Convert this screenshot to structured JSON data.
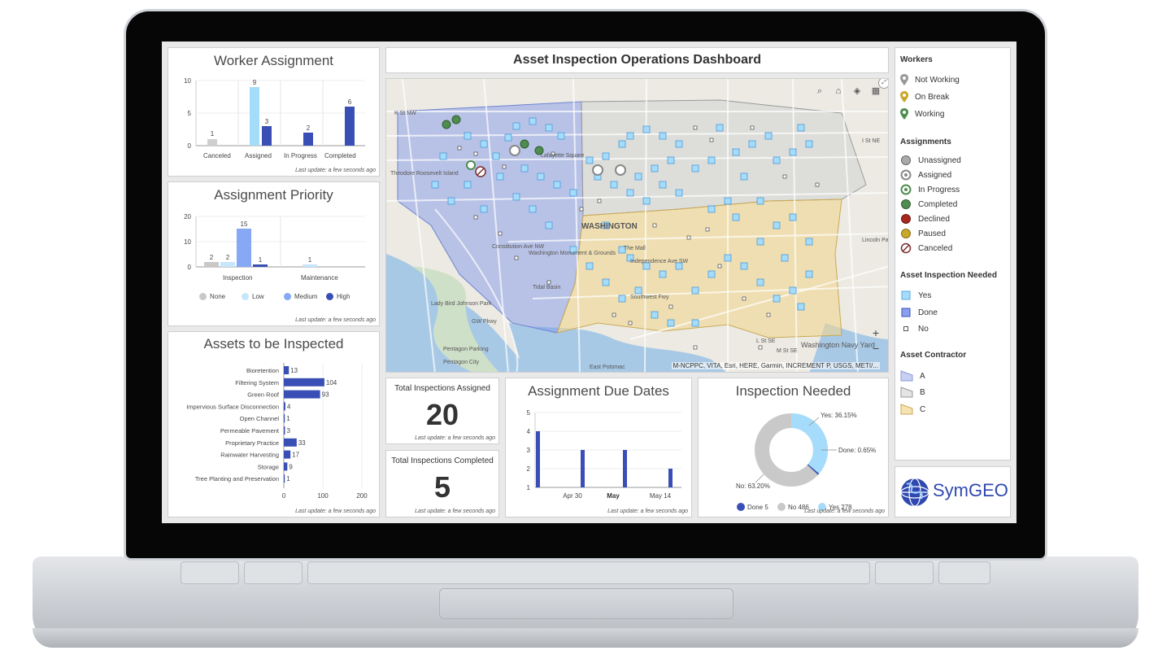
{
  "dashboard": {
    "title": "Asset Inspection Operations Dashboard",
    "update_text": "Last update: a few seconds ago"
  },
  "worker_assignment": {
    "title": "Worker Assignment",
    "chart_data": {
      "type": "bar",
      "categories": [
        "Canceled",
        "Assigned",
        "In Progress",
        "Completed"
      ],
      "bars": [
        {
          "category": "Canceled",
          "value": 1,
          "color": "#cfcfcf"
        },
        {
          "category": "Assigned",
          "value": 9,
          "color": "#a6dcfb"
        },
        {
          "category": "Assigned",
          "value": 3,
          "color": "#3a4fb5"
        },
        {
          "category": "In Progress",
          "value": 2,
          "color": "#3a4fb5"
        },
        {
          "category": "Completed",
          "value": 6,
          "color": "#3a4fb5"
        }
      ],
      "yticks": [
        "0",
        "5",
        "10"
      ],
      "ylim": [
        0,
        10
      ]
    }
  },
  "assignment_priority": {
    "title": "Assignment Priority",
    "chart_data": {
      "type": "bar",
      "categories": [
        "Inspection",
        "Maintenance"
      ],
      "series": [
        {
          "name": "None",
          "values": [
            2,
            0
          ],
          "color": "#c8c8c8"
        },
        {
          "name": "Low",
          "values": [
            2,
            1
          ],
          "color": "#c6e6fb"
        },
        {
          "name": "Medium",
          "values": [
            15,
            0
          ],
          "color": "#86a8f5"
        },
        {
          "name": "High",
          "values": [
            1,
            0
          ],
          "color": "#3a4fb5"
        }
      ],
      "yticks": [
        "0",
        "10",
        "20"
      ],
      "ylim": [
        0,
        20
      ]
    }
  },
  "assets_inspected": {
    "title": "Assets to be Inspected",
    "chart_data": {
      "type": "bar",
      "orientation": "horizontal",
      "categories": [
        "Bioretention",
        "Filtering System",
        "Green Roof",
        "Impervious Surface Disconnection",
        "Open Channel",
        "Permeable Pavement",
        "Proprietary Practice",
        "Rainwater Harvesting",
        "Storage",
        "Tree Planting and Preservation"
      ],
      "values": [
        13,
        104,
        93,
        4,
        1,
        3,
        33,
        17,
        9,
        1
      ],
      "xticks": [
        "0",
        "100",
        "200"
      ],
      "xlim": [
        0,
        200
      ],
      "color": "#3a4fb5"
    }
  },
  "total_assigned": {
    "title": "Total Inspections Assigned",
    "value": "20"
  },
  "total_completed": {
    "title": "Total Inspections Completed",
    "value": "5"
  },
  "due_dates": {
    "title": "Assignment Due Dates",
    "chart_data": {
      "type": "bar",
      "xticks": [
        "Apr 30",
        "May",
        "May 14"
      ],
      "yticks": [
        "1",
        "2",
        "3",
        "4",
        "5"
      ],
      "ylim": [
        1,
        5
      ],
      "values": [
        4,
        3,
        3,
        2
      ],
      "color": "#3a4fb5"
    }
  },
  "inspection_needed": {
    "title": "Inspection Needed",
    "chart_data": {
      "type": "pie",
      "slices": [
        {
          "name": "Yes",
          "value": 278,
          "pct": "36.15%",
          "color": "#a6dcfb"
        },
        {
          "name": "Done",
          "value": 5,
          "pct": "0.65%",
          "color": "#3a4fb5"
        },
        {
          "name": "No",
          "value": 486,
          "pct": "63.20%",
          "color": "#c9c9c9"
        }
      ],
      "labels": {
        "yes": "Yes: 36.15%",
        "done": "Done: 0.65%",
        "no": "No: 63.20%"
      },
      "legend": [
        {
          "label": "Done 5",
          "color": "#3a4fb5"
        },
        {
          "label": "No 486",
          "color": "#c9c9c9"
        },
        {
          "label": "Yes 278",
          "color": "#a6dcfb"
        }
      ]
    }
  },
  "map": {
    "attribution": "M-NCPPC, VITA, Esri, HERE, Garmin, INCREMENT P, USGS, METI/...",
    "place_labels": [
      "WASHINGTON",
      "Washington Navy Yard",
      "Constitution Ave NW",
      "Independence Ave SW",
      "Southwest Fwy",
      "East Potomac",
      "Pentagon City",
      "Lady Bird Johnson Park",
      "Tidal Basin",
      "Washington Monument & Grounds",
      "Lafayette Square",
      "Theodore Roosevelt Island",
      "The Mall",
      "Lincoln Park",
      "GW Pkwy",
      "Pentagon Parking",
      "K St NW",
      "I St NE",
      "L St SE",
      "M St SE"
    ],
    "zoom_in": "+",
    "zoom_out": "−"
  },
  "legend": {
    "workers_title": "Workers",
    "workers": [
      "Not Working",
      "On Break",
      "Working"
    ],
    "assignments_title": "Assignments",
    "assignments": [
      "Unassigned",
      "Assigned",
      "In Progress",
      "Completed",
      "Declined",
      "Paused",
      "Canceled"
    ],
    "asset_title": "Asset Inspection Needed",
    "asset": [
      "Yes",
      "Done",
      "No"
    ],
    "contractor_title": "Asset Contractor",
    "contractor": [
      "A",
      "B",
      "C"
    ]
  },
  "brand": {
    "name": "SymGEO"
  }
}
